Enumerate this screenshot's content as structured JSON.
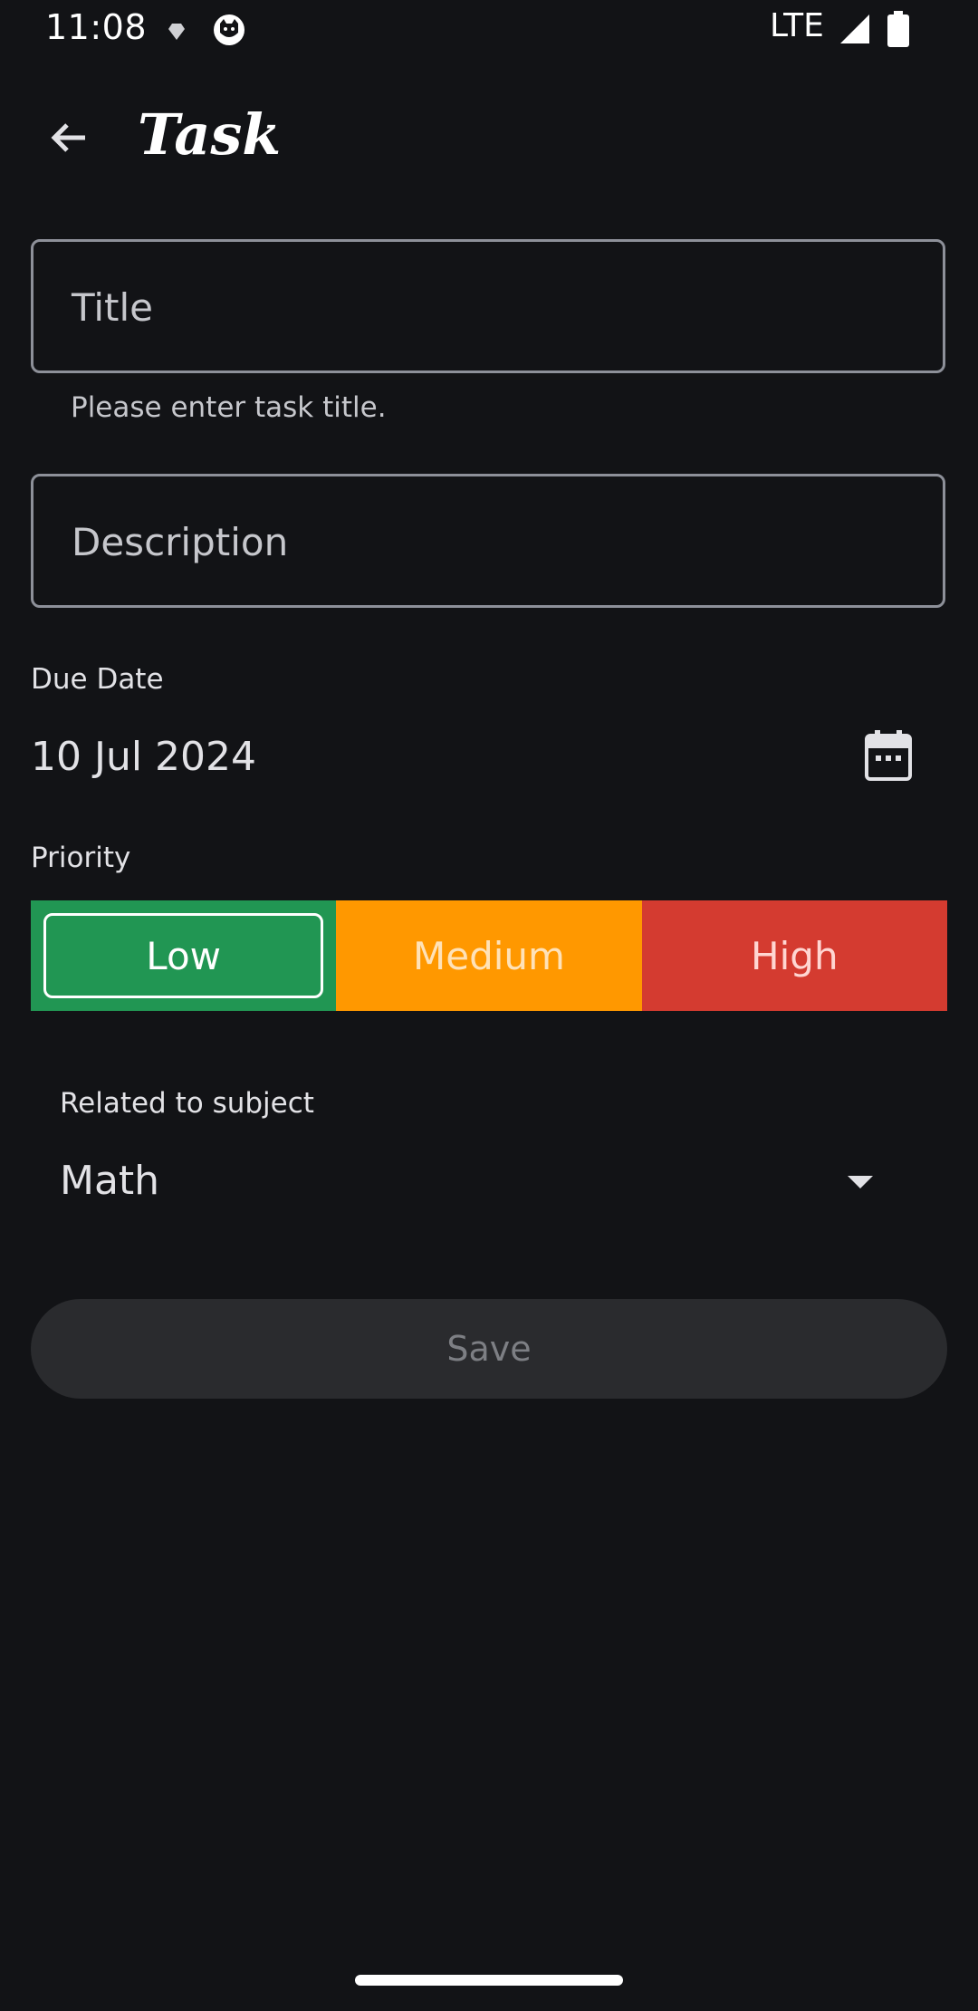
{
  "status_bar": {
    "time": "11:08",
    "network": "LTE",
    "icons": [
      "diamond-notification-icon",
      "cat-notification-icon",
      "signal-icon",
      "battery-icon"
    ]
  },
  "top_bar": {
    "title": "Task",
    "back_icon": "arrow-back-icon"
  },
  "form": {
    "title_field": {
      "placeholder": "Title",
      "value": "",
      "helper": "Please enter task title."
    },
    "description_field": {
      "placeholder": "Description",
      "value": ""
    },
    "due_date": {
      "label": "Due Date",
      "value": "10 Jul 2024",
      "icon": "calendar-icon"
    },
    "priority": {
      "label": "Priority",
      "options": [
        {
          "label": "Low",
          "color": "#219653",
          "selected": true
        },
        {
          "label": "Medium",
          "color": "#ff9800",
          "selected": false
        },
        {
          "label": "High",
          "color": "#d43b30",
          "selected": false
        }
      ]
    },
    "subject": {
      "label": "Related to subject",
      "value": "Math",
      "icon": "dropdown-arrow-icon"
    },
    "save_label": "Save"
  },
  "colors": {
    "background": "#121316",
    "save_disabled": "#2a2b2e"
  }
}
